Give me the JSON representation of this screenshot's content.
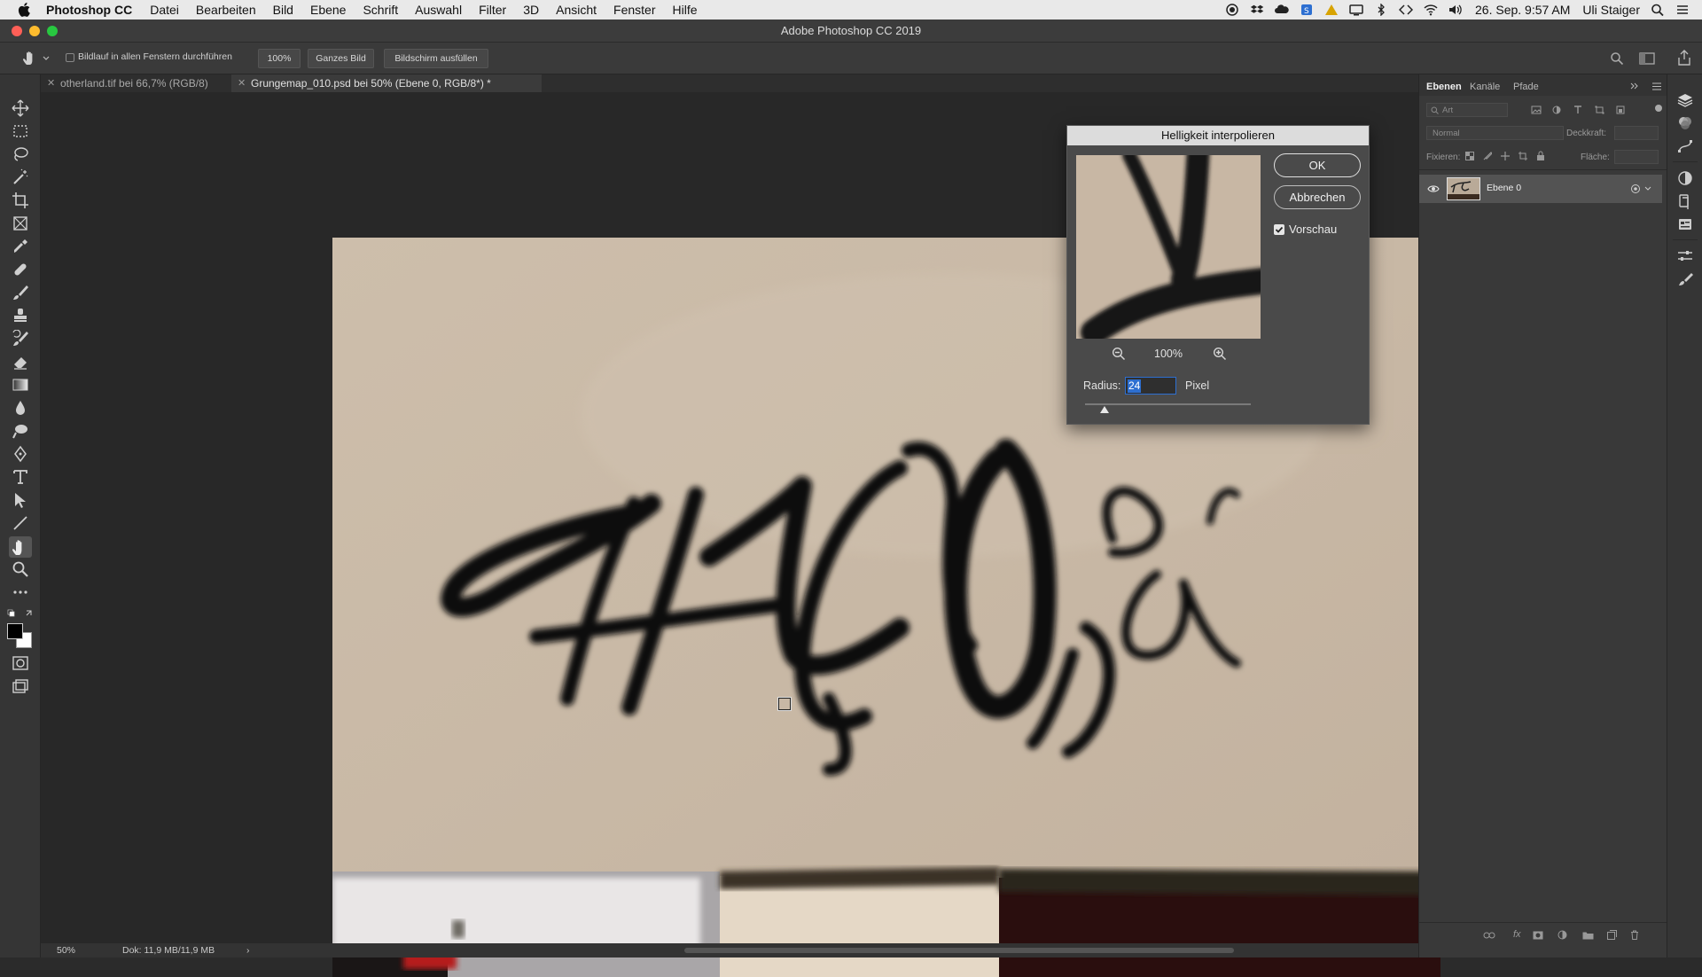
{
  "menubar": {
    "app_name": "Photoshop CC",
    "items": [
      "Datei",
      "Bearbeiten",
      "Bild",
      "Ebene",
      "Schrift",
      "Auswahl",
      "Filter",
      "3D",
      "Ansicht",
      "Fenster",
      "Hilfe"
    ],
    "date_time": "26. Sep.  9:57 AM",
    "user": "Uli Staiger"
  },
  "window": {
    "title": "Adobe Photoshop CC 2019"
  },
  "options_bar": {
    "scroll_all_label": "Bildlauf in allen Fenstern durchführen",
    "zoom_100_label": "100%",
    "fit_screen_label": "Ganzes Bild",
    "fill_screen_label": "Bildschirm ausfüllen"
  },
  "tabs": [
    {
      "label": "otherland.tif bei 66,7% (RGB/8)",
      "active": false
    },
    {
      "label": "Grungemap_010.psd bei 50% (Ebene 0, RGB/8*) *",
      "active": true
    }
  ],
  "status": {
    "zoom": "50%",
    "doc_size": "Dok: 11,9 MB/11,9 MB",
    "arrow": "›"
  },
  "dialog": {
    "title": "Helligkeit interpolieren",
    "ok_label": "OK",
    "cancel_label": "Abbrechen",
    "preview_label": "Vorschau",
    "preview_checked": true,
    "zoom_value": "100%",
    "radius_label": "Radius:",
    "radius_value": "24",
    "radius_unit": "Pixel",
    "radius_slider_position": 0.12
  },
  "layers_panel": {
    "tabs": [
      "Ebenen",
      "Kanäle",
      "Pfade"
    ],
    "filter_placeholder": "Art",
    "blend_mode": "Normal",
    "opacity_label": "Deckkraft:",
    "lock_label": "Fixieren:",
    "fill_label": "Fläche:",
    "layers": [
      {
        "name": "Ebene 0",
        "visible": true
      }
    ]
  },
  "colors": {
    "accent": "#2d6fd1",
    "panel_bg": "#393939",
    "canvas_wall": "#c9b9a6"
  }
}
